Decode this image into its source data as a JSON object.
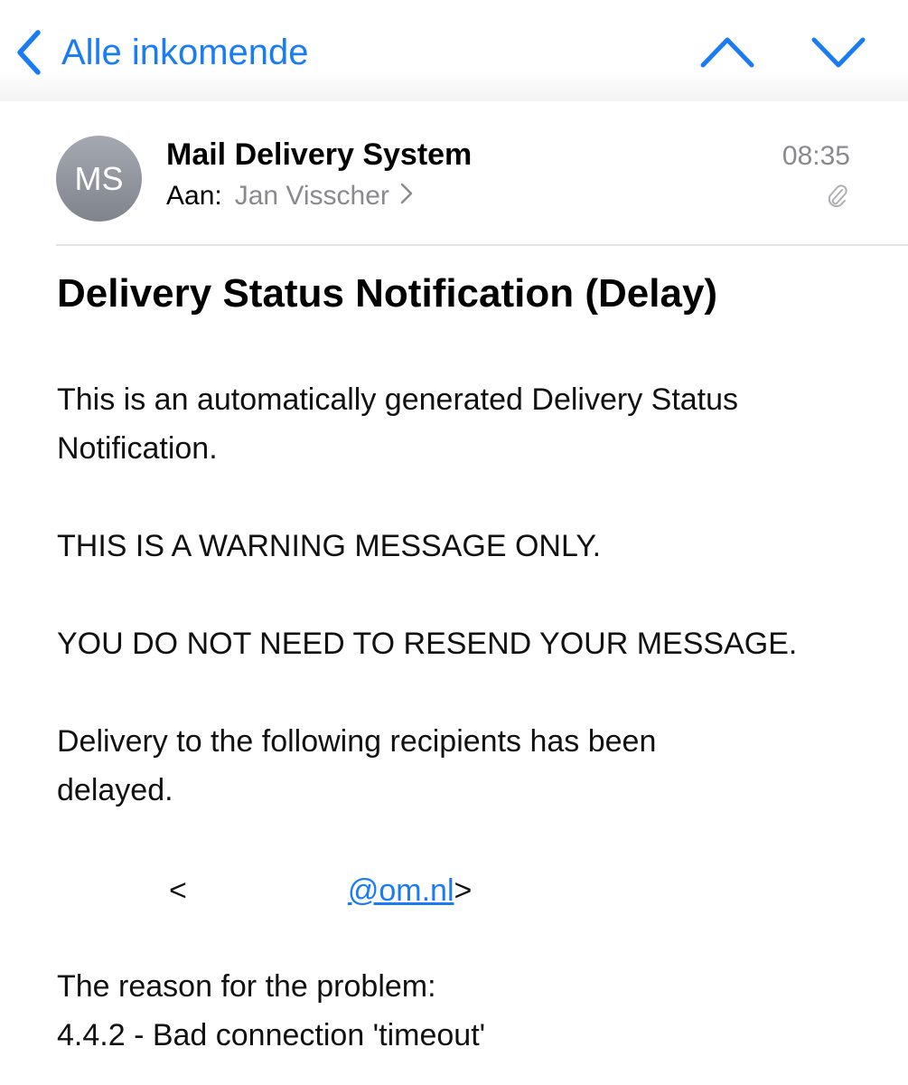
{
  "nav": {
    "back_label": "Alle inkomende",
    "accent_color": "#1a7cf5",
    "icons": [
      "back-chevron-icon",
      "chevron-up-icon",
      "chevron-down-icon"
    ]
  },
  "message": {
    "avatar_initials": "MS",
    "sender": "Mail Delivery System",
    "to_label": "Aan:",
    "to_name": "Jan Visscher",
    "time": "08:35",
    "attachment_icon": "paperclip-icon",
    "subject": "Delivery Status Notification (Delay)"
  },
  "body": {
    "line1": "This is an automatically generated Delivery Status",
    "line2": "Notification.",
    "warning": "THIS IS A WARNING MESSAGE ONLY.",
    "no_resend": "YOU DO NOT NEED TO RESEND YOUR MESSAGE.",
    "delivery_line1": "Delivery to the following recipients has been",
    "delivery_line2": "delayed.",
    "recipient_open": "<",
    "recipient_link": "@om.nl",
    "recipient_close": ">",
    "reason_label": "The reason for the problem:",
    "reason_detail": "4.4.2 - Bad connection 'timeout'"
  }
}
